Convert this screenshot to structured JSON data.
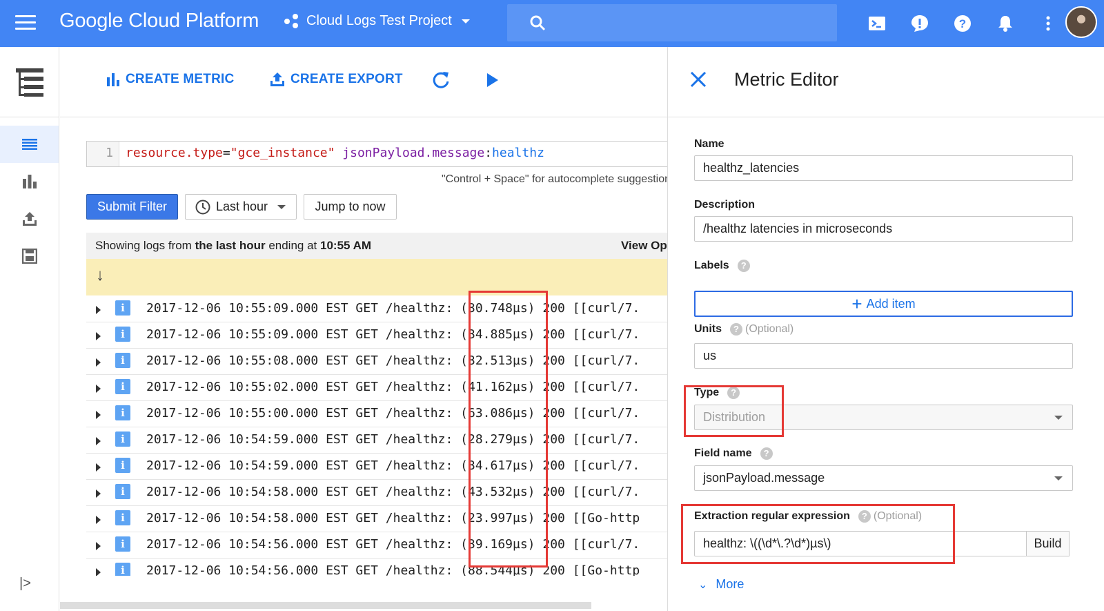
{
  "header": {
    "brand": "Google Cloud Platform",
    "project": "Cloud Logs Test Project"
  },
  "toolbar": {
    "create_metric": "CREATE METRIC",
    "create_export": "CREATE EXPORT"
  },
  "filter": {
    "line_number": "1",
    "key1": "resource.type",
    "eq": "=",
    "val1": "\"gce_instance\"",
    "key2": "jsonPayload.message",
    "colon": ":",
    "val2": "healthz",
    "hint": "\"Control + Space\" for autocomplete suggestions"
  },
  "controls": {
    "submit": "Submit Filter",
    "range": "Last hour",
    "jump": "Jump to now"
  },
  "status": {
    "prefix": "Showing logs from ",
    "bold1": "the last hour",
    "mid": " ending at ",
    "bold2": "10:55 AM",
    "view_options": "View Options"
  },
  "logs": [
    "2017-12-06 10:55:09.000 EST  GET /healthz: (30.748µs) 200 [[curl/7.",
    "2017-12-06 10:55:09.000 EST  GET /healthz: (34.885µs) 200 [[curl/7.",
    "2017-12-06 10:55:08.000 EST  GET /healthz: (32.513µs) 200 [[curl/7.",
    "2017-12-06 10:55:02.000 EST  GET /healthz: (41.162µs) 200 [[curl/7.",
    "2017-12-06 10:55:00.000 EST  GET /healthz: (63.086µs) 200 [[curl/7.",
    "2017-12-06 10:54:59.000 EST  GET /healthz: (28.279µs) 200 [[curl/7.",
    "2017-12-06 10:54:59.000 EST  GET /healthz: (34.617µs) 200 [[curl/7.",
    "2017-12-06 10:54:58.000 EST  GET /healthz: (43.532µs) 200 [[curl/7.",
    "2017-12-06 10:54:58.000 EST  GET /healthz: (23.997µs) 200 [[Go-http",
    "2017-12-06 10:54:56.000 EST  GET /healthz: (39.169µs) 200 [[curl/7.",
    "2017-12-06 10:54:56.000 EST  GET /healthz: (88.544µs) 200 [[Go-http"
  ],
  "editor": {
    "title": "Metric Editor",
    "name_label": "Name",
    "name_value": "healthz_latencies",
    "desc_label": "Description",
    "desc_value": "/healthz latencies in microseconds",
    "labels_label": "Labels",
    "add_item": "Add item",
    "units_label": "Units",
    "optional": "(Optional)",
    "units_value": "us",
    "type_label": "Type",
    "type_value": "Distribution",
    "field_label": "Field name",
    "field_value": "jsonPayload.message",
    "regex_label": "Extraction regular expression",
    "regex_value": "healthz: \\((\\d*\\.?\\d*)µs\\)",
    "build": "Build",
    "more": "More"
  },
  "colors": {
    "header_blue": "#4285f4",
    "accent_blue": "#1a73e8",
    "highlight_red": "#e53935",
    "banner_yellow": "#faeeb8"
  }
}
